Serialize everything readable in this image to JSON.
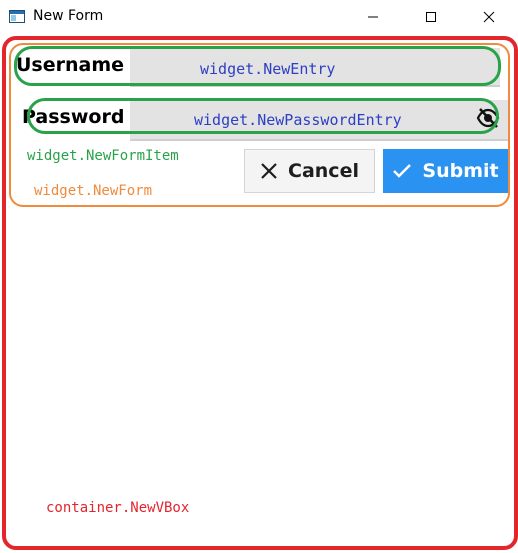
{
  "window": {
    "title": "New Form",
    "controls": [
      "minimize-icon",
      "maximize-icon",
      "close-icon"
    ]
  },
  "form": {
    "username_label": "Username",
    "username_entry_text": "widget.NewEntry",
    "password_label": "Password",
    "password_entry_text": "widget.NewPasswordEntry",
    "password_toggle_icon": "eye-slash-icon",
    "cancel_label": "Cancel",
    "cancel_icon": "close-icon",
    "submit_label": "Submit",
    "submit_icon": "check-icon"
  },
  "annotations": {
    "form_item": "widget.NewFormItem",
    "form": "widget.NewForm",
    "vbox": "container.NewVBox"
  },
  "colors": {
    "vbox_outline": "#e2262c",
    "form_outline": "#f08a3c",
    "form_item_outline": "#2aa24a",
    "entry_text": "#2d3fc4",
    "submit_bg": "#2a93f2"
  }
}
